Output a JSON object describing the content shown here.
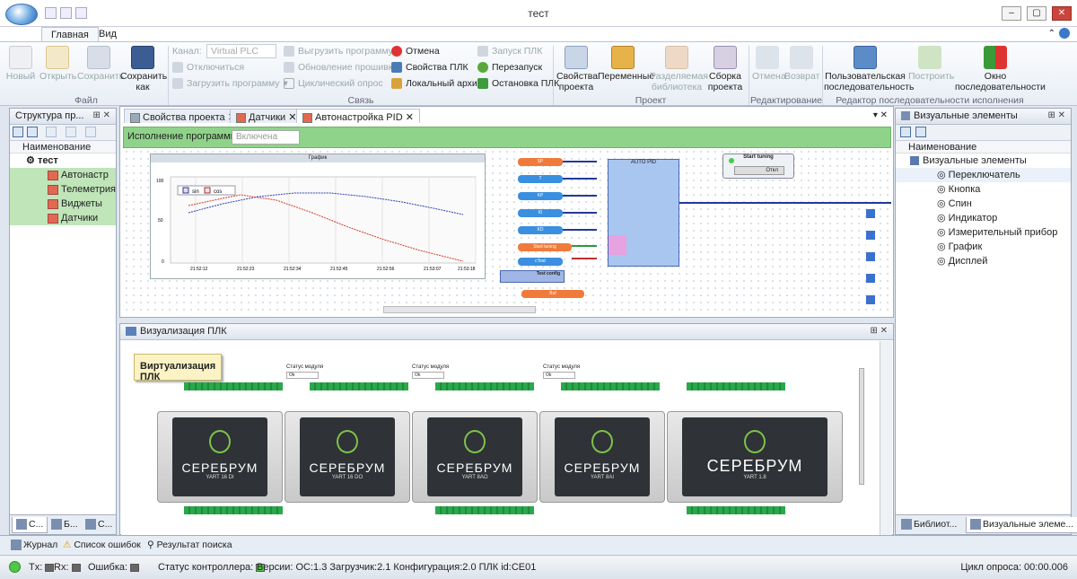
{
  "window": {
    "title": "тест"
  },
  "ribbon_tabs": [
    "Главная",
    "Вид"
  ],
  "ribbon": {
    "file": {
      "new": "Новый",
      "open": "Открыть",
      "save": "Сохранить",
      "save_as": "Сохранить как",
      "group": "Файл"
    },
    "link": {
      "channel_label": "Канал:",
      "channel_value": "Virtual PLC",
      "disconnect": "Отключиться",
      "upload": "Загрузить программу",
      "download": "Выгрузить программу",
      "firmware": "Обновление прошивки",
      "cyclic": "Циклический опрос",
      "cancel": "Отмена",
      "plc_props": "Свойства ПЛК",
      "local_archive": "Локальный архив",
      "start_plc": "Запуск ПЛК",
      "restart": "Перезапуск",
      "stop_plc": "Остановка ПЛК",
      "group": "Связь"
    },
    "project": {
      "props": "Свойства проекта",
      "variables": "Переменные",
      "shared_lib": "Разделяемая библиотека",
      "build": "Сборка проекта",
      "group": "Проект"
    },
    "edit": {
      "undo": "Отмена",
      "redo": "Возврат",
      "group": "Редактирование"
    },
    "sequence": {
      "user_seq": "Пользовательская последовательность",
      "build": "Построить",
      "window": "Окно последовательности",
      "group": "Редактор последовательности исполнения"
    }
  },
  "left_panel": {
    "title": "Структура пр...",
    "column": "Наименование",
    "root": "тест",
    "items": [
      "Автонастр",
      "Телеметрия",
      "Виджеты",
      "Датчики"
    ],
    "tabs": [
      "С...",
      "Б...",
      "С..."
    ]
  },
  "doc_tabs": [
    "Свойства проекта",
    "Датчики",
    "Автонастройка PID"
  ],
  "exec": {
    "label": "Исполнение программы:",
    "value": "Включена"
  },
  "graph": {
    "title": "График",
    "legend": [
      "sin",
      "cos"
    ],
    "yticks": [
      "100",
      "50",
      "0"
    ],
    "xticks": [
      "21:52:12",
      "21:52:23",
      "21:52:34",
      "21:52:45",
      "21:52:56",
      "21:53:07",
      "21:53:18"
    ]
  },
  "canvas": {
    "pid_title": "AUTO PID",
    "start_title": "Start tuning",
    "start_btn": "Откл",
    "inputs": [
      "SP",
      "T",
      "KP",
      "KI",
      "KD",
      "Start tuning",
      "cTest"
    ],
    "test_config": "Test config",
    "buf": "Buf"
  },
  "bottom_panel": {
    "title": "Визуализация ПЛК",
    "callout": "Виртуализация ПЛК",
    "status_label": "Статус модуля",
    "status_value": "Ok",
    "modules": [
      {
        "brand": "СЕРЕБРУМ",
        "model": "YART 16 DI"
      },
      {
        "brand": "СЕРЕБРУМ",
        "model": "YART 16 DO"
      },
      {
        "brand": "СЕРЕБРУМ",
        "model": "YART 8AO"
      },
      {
        "brand": "СЕРЕБРУМ",
        "model": "YART 8AI"
      },
      {
        "brand": "СЕРЕБРУМ",
        "model": "YART 1.8"
      }
    ]
  },
  "right_panel": {
    "title": "Визуальные элементы",
    "column": "Наименование",
    "root": "Визуальные элементы",
    "items": [
      "Переключатель",
      "Кнопка",
      "Спин",
      "Индикатор",
      "Измерительный прибор",
      "График",
      "Дисплей"
    ],
    "tabs": [
      "Библиот...",
      "Визуальные элеме..."
    ]
  },
  "log_tabs": [
    "Журнал",
    "Список ошибок",
    "Результат поиска"
  ],
  "status": {
    "tx": "Tx:",
    "rx": "Rx:",
    "error": "Ошибка:",
    "controller": "Статус контроллера:",
    "versions": "Версии: ОС:1.3 Загрузчик:2.1 Конфигурация:2.0 ПЛК id:CE01",
    "cycle": "Цикл опроса: 00:00.006"
  },
  "colors": {
    "green_bar": "#8fd38a",
    "sin": "#2e3fb5",
    "cos": "#d23a2a",
    "wire": "#223a9a"
  }
}
